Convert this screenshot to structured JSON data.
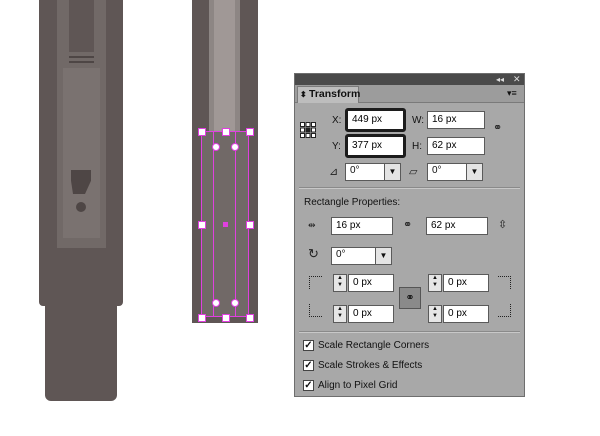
{
  "panel": {
    "title": "Transform",
    "x": "449 px",
    "y": "377 px",
    "w": "16 px",
    "h": "62 px",
    "x_label": "X:",
    "y_label": "Y:",
    "w_label": "W:",
    "h_label": "H:",
    "rotate_angle": "0°",
    "shear_angle": "0°",
    "rect_section": "Rectangle Properties:",
    "rect_width": "16 px",
    "rect_height": "62 px",
    "corner_rotate": "0°",
    "corner_tl": "0 px",
    "corner_tr": "0 px",
    "corner_bl": "0 px",
    "corner_br": "0 px",
    "checkboxes": [
      {
        "label": "Scale Rectangle Corners",
        "checked": true
      },
      {
        "label": "Scale Strokes & Effects",
        "checked": true
      },
      {
        "label": "Align to Pixel Grid",
        "checked": true
      }
    ]
  },
  "colors": {
    "artwork_dark": "#5f5655",
    "artwork_mid": "#716967",
    "selection": "#e040e0",
    "panel_bg": "#a8a8a8"
  }
}
